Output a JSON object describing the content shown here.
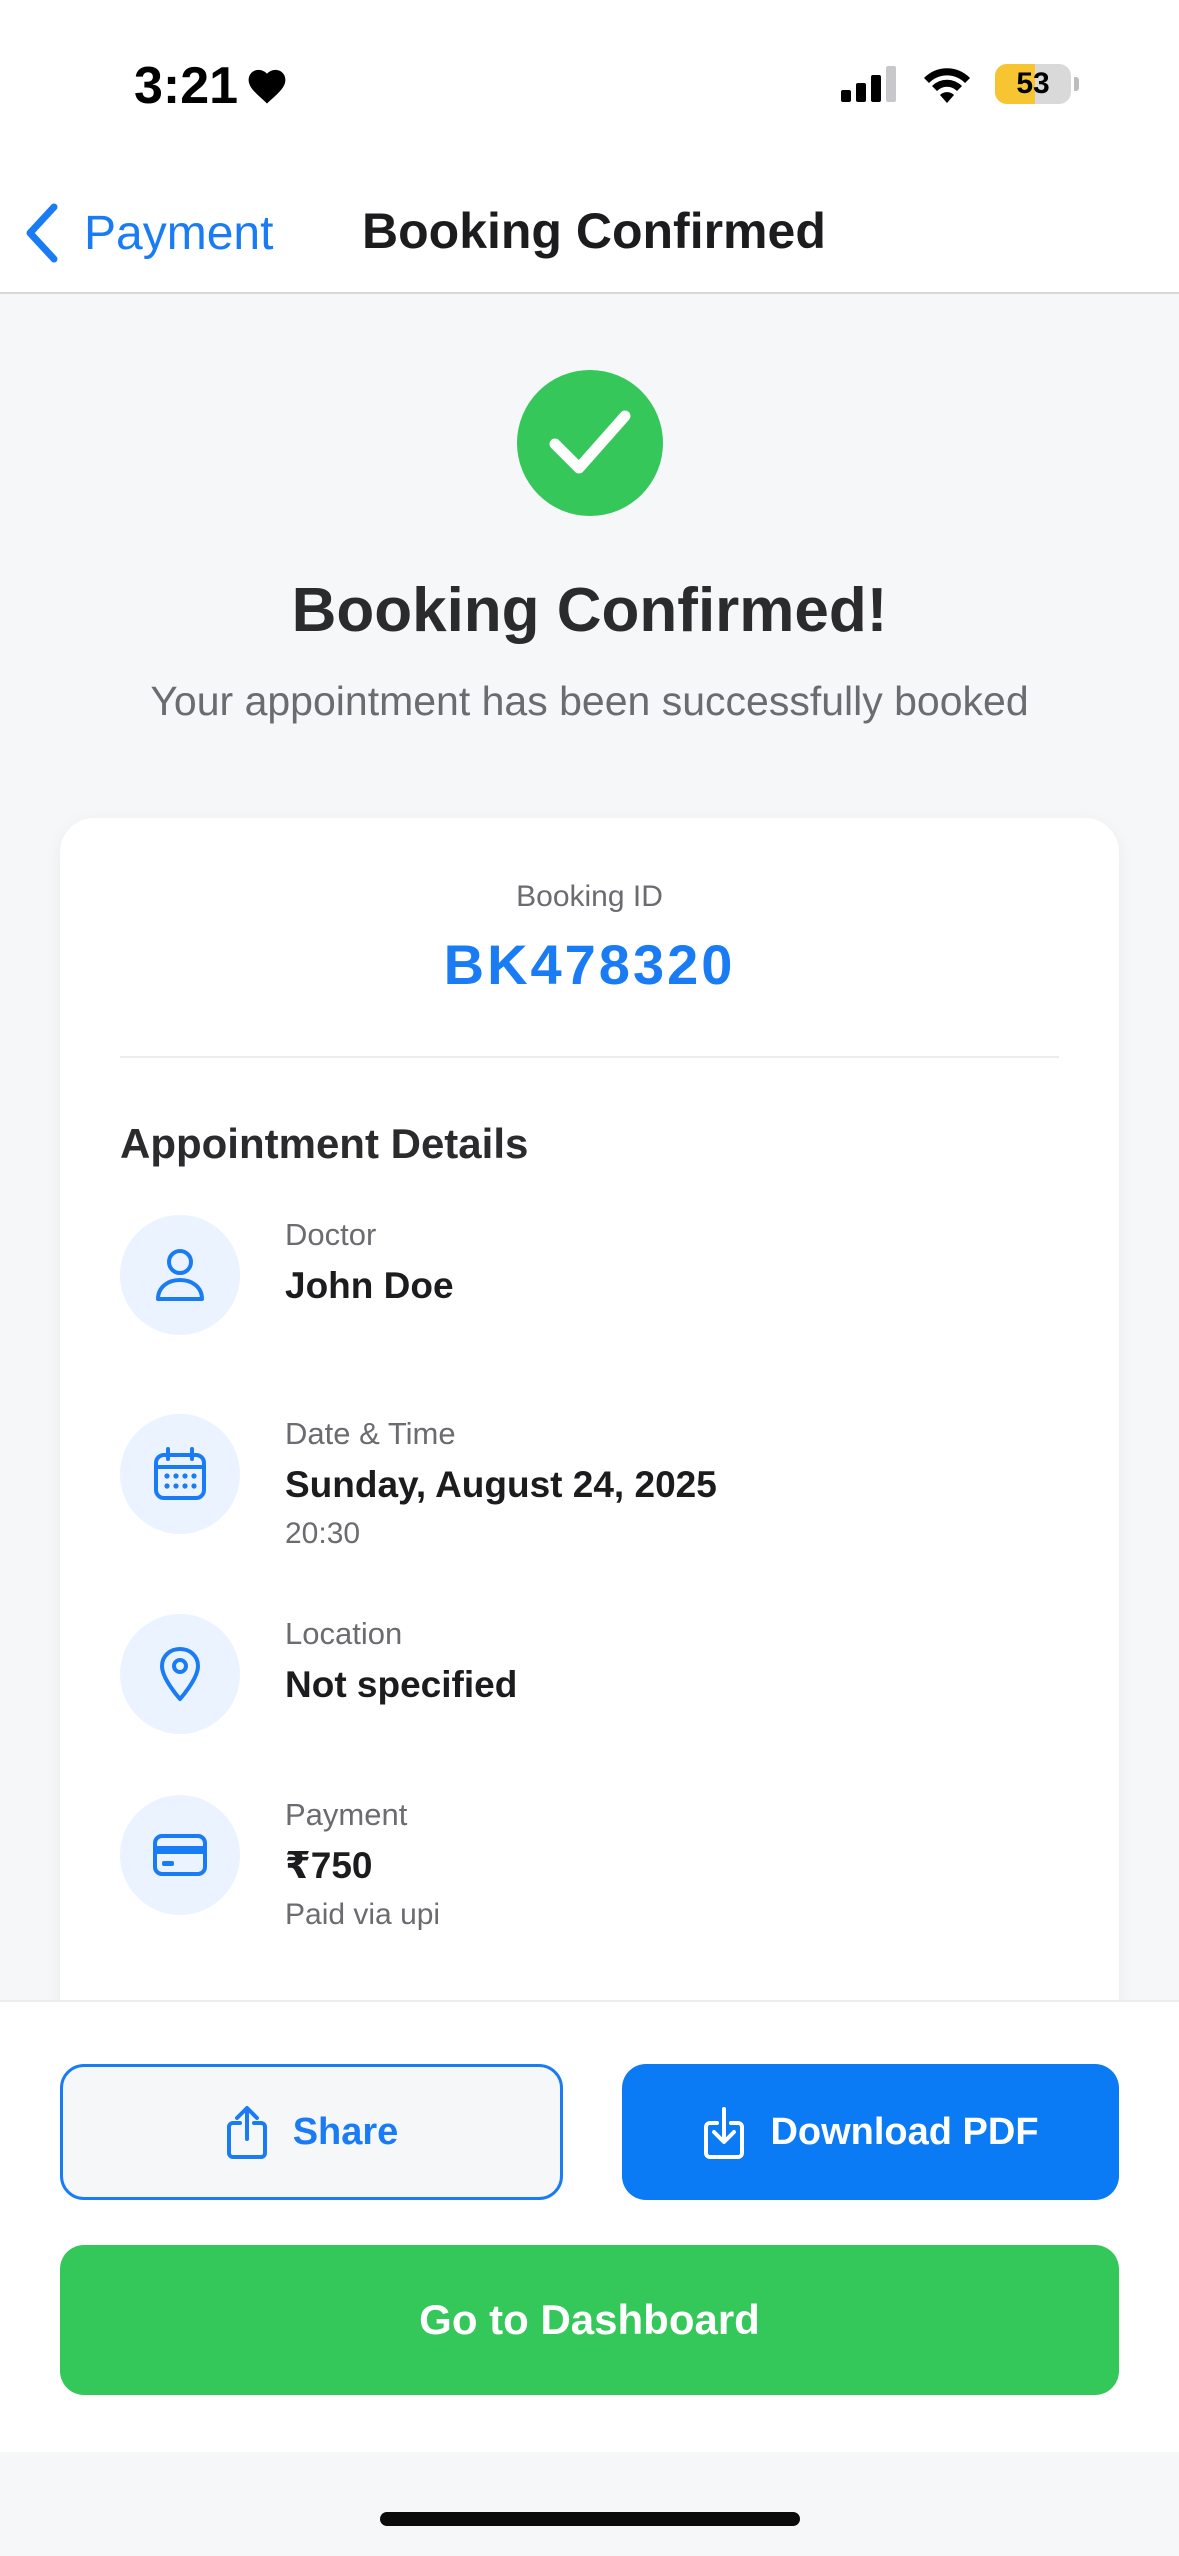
{
  "status_bar": {
    "time": "3:21",
    "battery": "53"
  },
  "nav": {
    "back_label": "Payment",
    "title": "Booking Confirmed"
  },
  "hero": {
    "title": "Booking Confirmed!",
    "subtitle": "Your appointment has been successfully booked"
  },
  "booking": {
    "id_label": "Booking ID",
    "id_value": "BK478320"
  },
  "details": {
    "section_title": "Appointment Details",
    "doctor": {
      "label": "Doctor",
      "value": "John Doe",
      "icon": "user-icon"
    },
    "datetime": {
      "label": "Date & Time",
      "value": "Sunday, August 24, 2025",
      "extra": "20:30",
      "icon": "calendar-icon"
    },
    "location": {
      "label": "Location",
      "value": "Not specified",
      "icon": "location-pin-icon"
    },
    "payment": {
      "label": "Payment",
      "value": "₹750",
      "extra": "Paid via upi",
      "icon": "credit-card-icon"
    }
  },
  "actions": {
    "share_label": "Share",
    "download_label": "Download PDF",
    "dashboard_label": "Go to Dashboard"
  },
  "colors": {
    "accent": "#1a7cf5",
    "success": "#34c759",
    "battery": "#f6c531"
  }
}
